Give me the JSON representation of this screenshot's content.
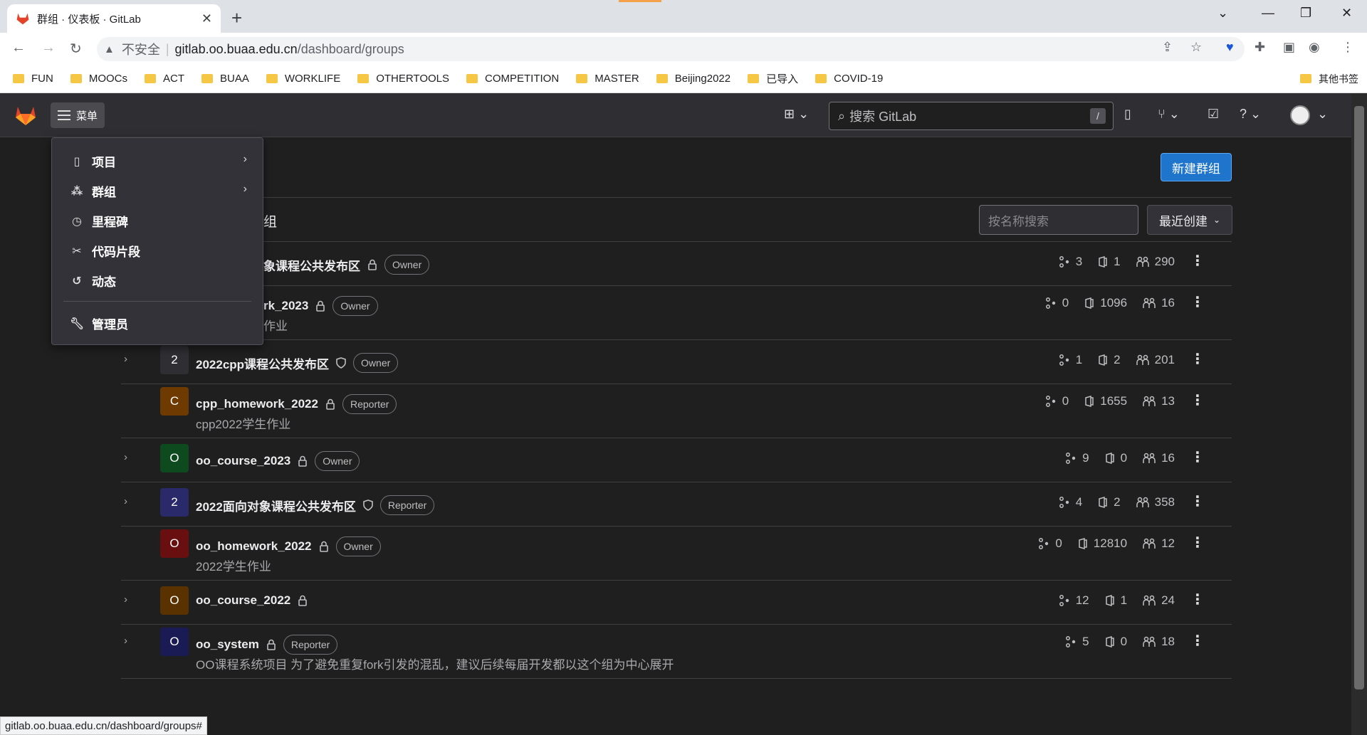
{
  "browser": {
    "tab_title": "群组 · 仪表板 · GitLab",
    "url_warning": "不安全",
    "url_host": "gitlab.oo.buaa.edu.cn",
    "url_path": "/dashboard/groups",
    "bookmarks": [
      "FUN",
      "MOOCs",
      "ACT",
      "BUAA",
      "WORKLIFE",
      "OTHERTOOLS",
      "COMPETITION",
      "MASTER",
      "Beijing2022",
      "已导入",
      "COVID-19"
    ],
    "other_bookmarks": "其他书签",
    "status_url": "gitlab.oo.buaa.edu.cn/dashboard/groups#"
  },
  "header": {
    "menu_label": "菜单",
    "search_placeholder": "搜索 GitLab",
    "search_shortcut": "/"
  },
  "menu": {
    "items": [
      {
        "label": "项目",
        "icon": "project-icon",
        "has_arrow": true
      },
      {
        "label": "群组",
        "icon": "group-icon",
        "has_arrow": true
      },
      {
        "label": "里程碑",
        "icon": "clock-icon",
        "has_arrow": false
      },
      {
        "label": "代码片段",
        "icon": "scissors-icon",
        "has_arrow": false
      },
      {
        "label": "动态",
        "icon": "history-icon",
        "has_arrow": false
      },
      {
        "label": "管理员",
        "icon": "wrench-icon",
        "has_arrow": false
      }
    ]
  },
  "page": {
    "new_group_label": "新建群组",
    "title_partial": "组",
    "filter_placeholder": "按名称搜索",
    "sort_label": "最近创建"
  },
  "groups": [
    {
      "name_partial": "象课程公共发布区",
      "role": "Owner",
      "visibility": "private",
      "subgroups": "3",
      "projects": "1",
      "members": "290",
      "expandable": true
    },
    {
      "name_partial": "rk_2023",
      "desc_partial": "作业",
      "role": "Owner",
      "visibility": "private",
      "subgroups": "0",
      "projects": "1096",
      "members": "16",
      "expandable": false
    },
    {
      "avatar": "2",
      "avatar_color": "#2e2e33",
      "name": "2022cpp课程公共发布区",
      "role": "Owner",
      "visibility": "internal",
      "subgroups": "1",
      "projects": "2",
      "members": "201",
      "expandable": true
    },
    {
      "avatar": "C",
      "avatar_color": "#6e3a00",
      "name": "cpp_homework_2022",
      "desc": "cpp2022学生作业",
      "role": "Reporter",
      "visibility": "private",
      "subgroups": "0",
      "projects": "1655",
      "members": "13",
      "expandable": false
    },
    {
      "avatar": "O",
      "avatar_color": "#0d4a1e",
      "name": "oo_course_2023",
      "role": "Owner",
      "visibility": "private",
      "subgroups": "9",
      "projects": "0",
      "members": "16",
      "expandable": true
    },
    {
      "avatar": "2",
      "avatar_color": "#2a2a6a",
      "name": "2022面向对象课程公共发布区",
      "role": "Reporter",
      "visibility": "internal",
      "subgroups": "4",
      "projects": "2",
      "members": "358",
      "expandable": true
    },
    {
      "avatar": "O",
      "avatar_color": "#6a0f0f",
      "name": "oo_homework_2022",
      "desc": "2022学生作业",
      "role": "Owner",
      "visibility": "private",
      "subgroups": "0",
      "projects": "12810",
      "members": "12",
      "expandable": false
    },
    {
      "avatar": "O",
      "avatar_color": "#5a3200",
      "name": "oo_course_2022",
      "role": "",
      "visibility": "private",
      "subgroups": "12",
      "projects": "1",
      "members": "24",
      "expandable": true
    },
    {
      "avatar": "O",
      "avatar_color": "#1a1a55",
      "name": "oo_system",
      "desc": "OO课程系统项目 为了避免重复fork引发的混乱，建议后续每届开发都以这个组为中心展开",
      "role": "Reporter",
      "visibility": "private",
      "subgroups": "5",
      "projects": "0",
      "members": "18",
      "expandable": true
    }
  ]
}
